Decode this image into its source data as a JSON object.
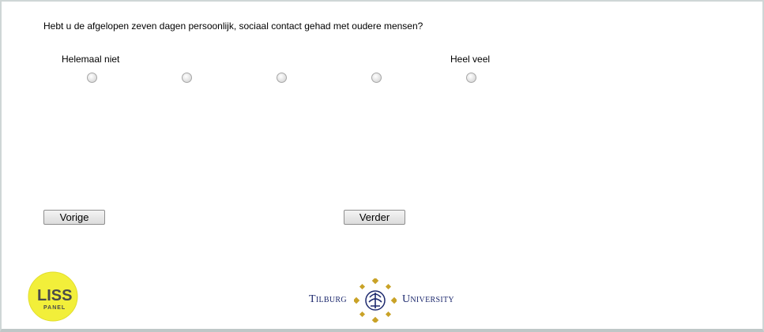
{
  "question": "Hebt u de afgelopen zeven dagen persoonlijk, sociaal contact gehad met oudere mensen?",
  "scale": {
    "left_label": "Helemaal niet",
    "right_label": "Heel veel",
    "options_count": 5,
    "selected": null
  },
  "buttons": {
    "prev_label": "Vorige",
    "next_label": "Verder"
  },
  "footer": {
    "liss_text": "LISS",
    "liss_sub": "PANEL",
    "university_left": "Tilburg",
    "university_right": "University",
    "brand_yellow": "#f2ef3a",
    "brand_navy": "#1e2a6e",
    "brand_gold": "#c9a227"
  }
}
